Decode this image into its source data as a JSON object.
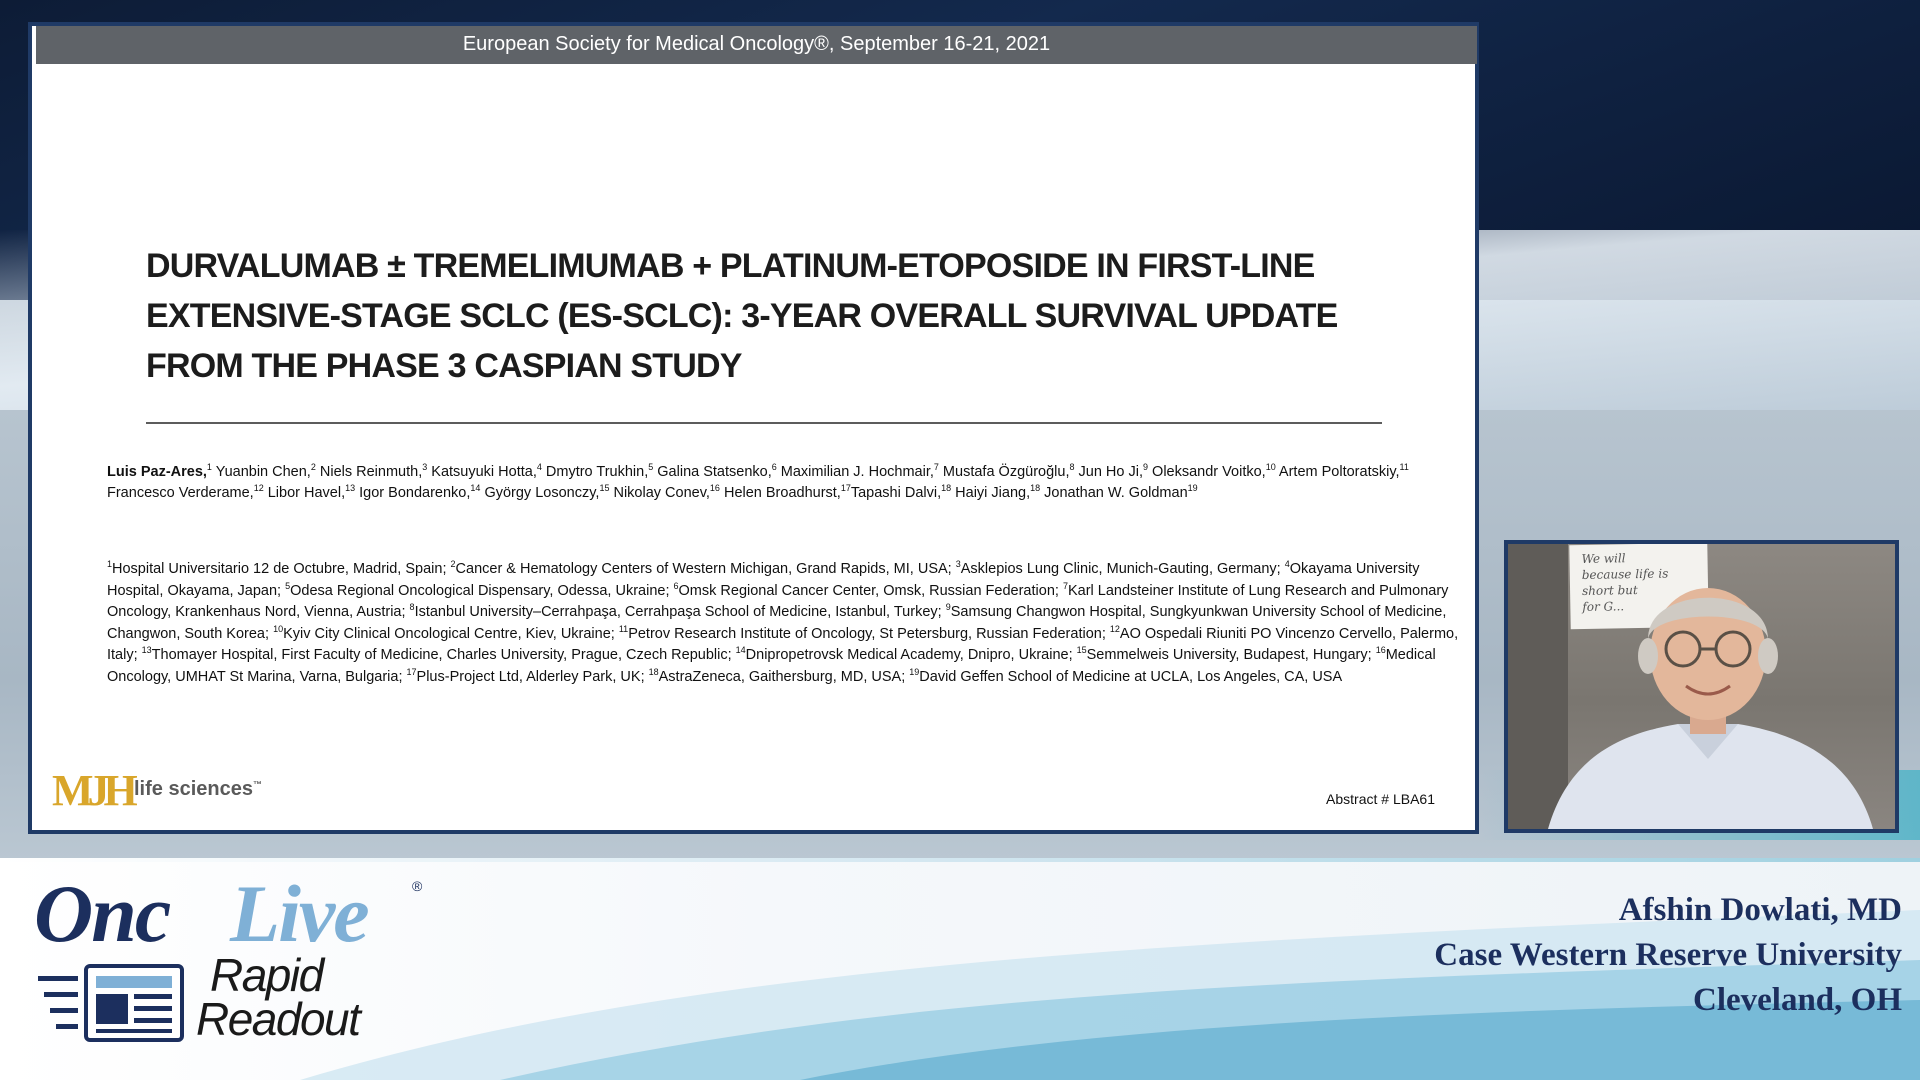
{
  "slide": {
    "header": "European Society for Medical Oncology®, September 16-21, 2021",
    "title_lines": [
      "DURVALUMAB ± TREMELIMUMAB + PLATINUM-ETOPOSIDE IN FIRST-LINE",
      "EXTENSIVE-STAGE SCLC (ES-SCLC): 3-YEAR OVERALL SURVIVAL UPDATE",
      "FROM THE PHASE 3 CASPIAN STUDY"
    ],
    "lead_author": "Luis Paz-Ares,",
    "authors": [
      {
        "sup": "1",
        "name": " Yuanbin Chen,"
      },
      {
        "sup": "2",
        "name": " Niels Reinmuth,"
      },
      {
        "sup": "3",
        "name": " Katsuyuki Hotta,"
      },
      {
        "sup": "4",
        "name": " Dmytro Trukhin,"
      },
      {
        "sup": "5",
        "name": " Galina Statsenko,"
      },
      {
        "sup": "6",
        "name": " Maximilian J. Hochmair,"
      },
      {
        "sup": "7",
        "name": " Mustafa Özgüroğlu,"
      },
      {
        "sup": "8",
        "name": " Jun Ho Ji,"
      },
      {
        "sup": "9",
        "name": " Oleksandr Voitko,"
      },
      {
        "sup": "10",
        "name": " Artem Poltoratskiy,"
      },
      {
        "sup": "11",
        "name": " Francesco Verderame,"
      },
      {
        "sup": "12",
        "name": " Libor Havel,"
      },
      {
        "sup": "13",
        "name": " Igor Bondarenko,"
      },
      {
        "sup": "14",
        "name": " György Losonczy,"
      },
      {
        "sup": "15",
        "name": " Nikolay Conev,"
      },
      {
        "sup": "16",
        "name": " Helen Broadhurst,"
      },
      {
        "sup": "17",
        "name": "Tapashi Dalvi,"
      },
      {
        "sup": "18",
        "name": " Haiyi Jiang,"
      },
      {
        "sup": "18",
        "name": " Jonathan W. Goldman"
      },
      {
        "sup": "19",
        "name": ""
      }
    ],
    "affiliations": [
      {
        "sup": "1",
        "text": "Hospital Universitario 12 de Octubre, Madrid, Spain; "
      },
      {
        "sup": "2",
        "text": "Cancer & Hematology Centers of Western Michigan, Grand Rapids, MI, USA; "
      },
      {
        "sup": "3",
        "text": "Asklepios Lung Clinic, Munich-Gauting, Germany; "
      },
      {
        "sup": "4",
        "text": "Okayama University Hospital, Okayama, Japan; "
      },
      {
        "sup": "5",
        "text": "Odesa Regional Oncological Dispensary, Odessa, Ukraine; "
      },
      {
        "sup": "6",
        "text": "Omsk Regional Cancer Center, Omsk, Russian Federation; "
      },
      {
        "sup": "7",
        "text": "Karl Landsteiner Institute of Lung Research and Pulmonary Oncology, Krankenhaus Nord, Vienna, Austria; "
      },
      {
        "sup": "8",
        "text": "Istanbul University–Cerrahpaşa, Cerrahpaşa School of Medicine, Istanbul, Turkey; "
      },
      {
        "sup": "9",
        "text": "Samsung Changwon Hospital, Sungkyunkwan University School of Medicine, Changwon, South Korea; "
      },
      {
        "sup": "10",
        "text": "Kyiv City Clinical Oncological Centre, Kiev, Ukraine; "
      },
      {
        "sup": "11",
        "text": "Petrov Research Institute of Oncology, St Petersburg, Russian Federation; "
      },
      {
        "sup": "12",
        "text": "AO Ospedali Riuniti PO Vincenzo Cervello, Palermo, Italy; "
      },
      {
        "sup": "13",
        "text": "Thomayer Hospital, First Faculty of Medicine, Charles University, Prague, Czech Republic; "
      },
      {
        "sup": "14",
        "text": "Dnipropetrovsk Medical Academy, Dnipro, Ukraine; "
      },
      {
        "sup": "15",
        "text": "Semmelweis University, Budapest, Hungary; "
      },
      {
        "sup": "16",
        "text": "Medical Oncology, UMHAT St Marina, Varna, Bulgaria; "
      },
      {
        "sup": "17",
        "text": "Plus-Project Ltd, Alderley Park, UK; "
      },
      {
        "sup": "18",
        "text": "AstraZeneca, Gaithersburg, MD, USA; "
      },
      {
        "sup": "19",
        "text": "David Geffen School of Medicine at UCLA, Los Angeles, CA, USA"
      }
    ],
    "logo_mark": "MJH",
    "logo_text": "life sciences",
    "logo_tm": "™",
    "abstract": "Abstract # LBA61"
  },
  "webcam": {
    "note_lines": [
      "We will",
      "because life is",
      "short but",
      "for G..."
    ]
  },
  "branding": {
    "onc": "Onc",
    "live": "Live",
    "reg": "®",
    "rapid": "Rapid",
    "readout": "Readout"
  },
  "speaker": {
    "name": "Afshin Dowlati, MD",
    "institution": "Case Western Reserve University",
    "location": "Cleveland, OH"
  },
  "colors": {
    "frame": "#1f3a66",
    "brand_dark": "#1c2f5e",
    "brand_light": "#7fb0d6",
    "mjh_gold": "#d9a62b"
  }
}
